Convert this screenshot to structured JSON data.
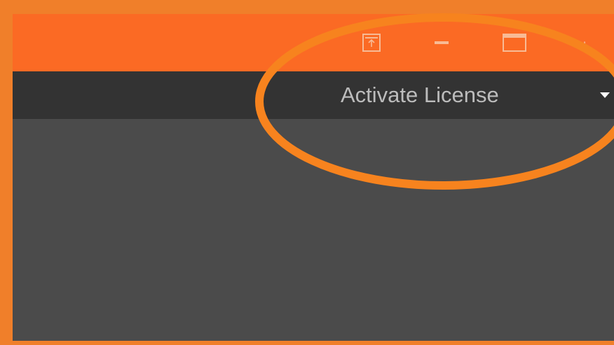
{
  "colors": {
    "frame": "#f07f2a",
    "titlebar": "#fb6a24",
    "menubar": "#333333",
    "content": "#4b4b4b",
    "highlight_ring": "#f7831e"
  },
  "titlebar": {
    "buttons": [
      {
        "icon": "upload-icon"
      },
      {
        "icon": "minimize-icon"
      },
      {
        "icon": "maximize-icon"
      },
      {
        "icon": "close-icon"
      }
    ]
  },
  "menubar": {
    "activate_label": "Activate License",
    "dropdown_icon": "caret-down-icon"
  },
  "annotation": {
    "shape": "ellipse-highlight"
  }
}
